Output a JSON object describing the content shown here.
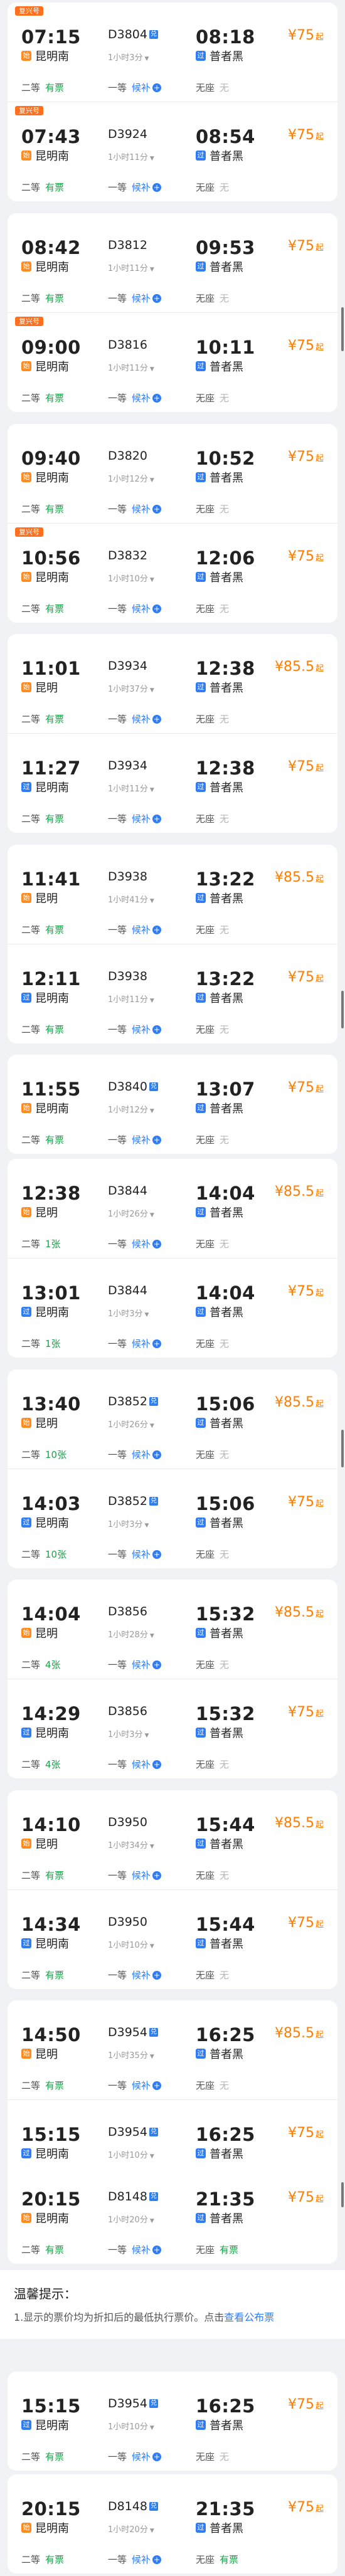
{
  "labels": {
    "second_class": "二等",
    "first_class": "一等",
    "no_seat": "无座",
    "from_suffix": "起",
    "revision_tag": "复兴号",
    "revision_badge": "兑",
    "start_icon": "始",
    "pass_icon": "过"
  },
  "groups": [
    {
      "trains": [
        {
          "tag": "复兴号",
          "dep_time": "07:15",
          "train_no": "D3804",
          "badge": true,
          "arr_time": "08:18",
          "dep_station": "昆明南",
          "dep_type": "start",
          "arr_station": "普者黑",
          "duration": "1小时3分",
          "price": "¥75",
          "second": "有票",
          "first": "候补",
          "none": "无"
        },
        {
          "tag": "复兴号",
          "dep_time": "07:43",
          "train_no": "D3924",
          "badge": false,
          "arr_time": "08:54",
          "dep_station": "昆明南",
          "dep_type": "start",
          "arr_station": "普者黑",
          "duration": "1小时11分",
          "price": "¥75",
          "second": "有票",
          "first": "候补",
          "none": "无"
        }
      ]
    },
    {
      "trains": [
        {
          "tag": "",
          "dep_time": "08:42",
          "train_no": "D3812",
          "badge": false,
          "arr_time": "09:53",
          "dep_station": "昆明南",
          "dep_type": "start",
          "arr_station": "普者黑",
          "duration": "1小时11分",
          "price": "¥75",
          "second": "有票",
          "first": "候补",
          "none": "无"
        },
        {
          "tag": "复兴号",
          "dep_time": "09:00",
          "train_no": "D3816",
          "badge": false,
          "arr_time": "10:11",
          "dep_station": "昆明南",
          "dep_type": "start",
          "arr_station": "普者黑",
          "duration": "1小时11分",
          "price": "¥75",
          "second": "有票",
          "first": "候补",
          "none": "无"
        }
      ]
    },
    {
      "trains": [
        {
          "tag": "",
          "dep_time": "09:40",
          "train_no": "D3820",
          "badge": false,
          "arr_time": "10:52",
          "dep_station": "昆明南",
          "dep_type": "start",
          "arr_station": "普者黑",
          "duration": "1小时12分",
          "price": "¥75",
          "second": "有票",
          "first": "候补",
          "none": "无"
        },
        {
          "tag": "复兴号",
          "dep_time": "10:56",
          "train_no": "D3832",
          "badge": false,
          "arr_time": "12:06",
          "dep_station": "昆明南",
          "dep_type": "start",
          "arr_station": "普者黑",
          "duration": "1小时10分",
          "price": "¥75",
          "second": "有票",
          "first": "候补",
          "none": "无"
        }
      ]
    },
    {
      "trains": [
        {
          "tag": "",
          "dep_time": "11:01",
          "train_no": "D3934",
          "badge": false,
          "arr_time": "12:38",
          "dep_station": "昆明",
          "dep_type": "start",
          "arr_station": "普者黑",
          "duration": "1小时37分",
          "price": "¥85.5",
          "second": "有票",
          "first": "候补",
          "none": "无"
        },
        {
          "tag": "",
          "dep_time": "11:27",
          "train_no": "D3934",
          "badge": false,
          "arr_time": "12:38",
          "dep_station": "昆明南",
          "dep_type": "pass",
          "arr_station": "普者黑",
          "duration": "1小时11分",
          "price": "¥75",
          "second": "有票",
          "first": "候补",
          "none": "无"
        }
      ]
    },
    {
      "trains": [
        {
          "tag": "",
          "dep_time": "11:41",
          "train_no": "D3938",
          "badge": false,
          "arr_time": "13:22",
          "dep_station": "昆明",
          "dep_type": "start",
          "arr_station": "普者黑",
          "duration": "1小时41分",
          "price": "¥85.5",
          "second": "有票",
          "first": "候补",
          "none": "无"
        },
        {
          "tag": "",
          "dep_time": "12:11",
          "train_no": "D3938",
          "badge": false,
          "arr_time": "13:22",
          "dep_station": "昆明南",
          "dep_type": "pass",
          "arr_station": "普者黑",
          "duration": "1小时11分",
          "price": "¥75",
          "second": "有票",
          "first": "候补",
          "none": "无"
        }
      ]
    },
    {
      "trains": [
        {
          "tag": "",
          "dep_time": "11:55",
          "train_no": "D3840",
          "badge": true,
          "arr_time": "13:07",
          "dep_station": "昆明南",
          "dep_type": "start",
          "arr_station": "普者黑",
          "duration": "1小时12分",
          "price": "¥75",
          "second": "有票",
          "first": "候补",
          "none": "无"
        }
      ]
    },
    {
      "trains": [
        {
          "tag": "",
          "dep_time": "12:38",
          "train_no": "D3844",
          "badge": false,
          "arr_time": "14:04",
          "dep_station": "昆明",
          "dep_type": "start",
          "arr_station": "普者黑",
          "duration": "1小时26分",
          "price": "¥85.5",
          "second": "1张",
          "first": "候补",
          "none": "无"
        },
        {
          "tag": "",
          "dep_time": "13:01",
          "train_no": "D3844",
          "badge": false,
          "arr_time": "14:04",
          "dep_station": "昆明南",
          "dep_type": "pass",
          "arr_station": "普者黑",
          "duration": "1小时3分",
          "price": "¥75",
          "second": "1张",
          "first": "候补",
          "none": "无"
        }
      ]
    },
    {
      "trains": [
        {
          "tag": "",
          "dep_time": "13:40",
          "train_no": "D3852",
          "badge": true,
          "arr_time": "15:06",
          "dep_station": "昆明",
          "dep_type": "start",
          "arr_station": "普者黑",
          "duration": "1小时26分",
          "price": "¥85.5",
          "second": "10张",
          "first": "候补",
          "none": "无"
        },
        {
          "tag": "",
          "dep_time": "14:03",
          "train_no": "D3852",
          "badge": true,
          "arr_time": "15:06",
          "dep_station": "昆明南",
          "dep_type": "pass",
          "arr_station": "普者黑",
          "duration": "1小时3分",
          "price": "¥75",
          "second": "10张",
          "first": "候补",
          "none": "无"
        }
      ]
    },
    {
      "trains": [
        {
          "tag": "",
          "dep_time": "14:04",
          "train_no": "D3856",
          "badge": false,
          "arr_time": "15:32",
          "dep_station": "昆明",
          "dep_type": "start",
          "arr_station": "普者黑",
          "duration": "1小时28分",
          "price": "¥85.5",
          "second": "4张",
          "first": "候补",
          "none": "无"
        },
        {
          "tag": "",
          "dep_time": "14:29",
          "train_no": "D3856",
          "badge": false,
          "arr_time": "15:32",
          "dep_station": "昆明南",
          "dep_type": "pass",
          "arr_station": "普者黑",
          "duration": "1小时3分",
          "price": "¥75",
          "second": "4张",
          "first": "候补",
          "none": "无"
        }
      ]
    },
    {
      "trains": [
        {
          "tag": "",
          "dep_time": "14:10",
          "train_no": "D3950",
          "badge": false,
          "arr_time": "15:44",
          "dep_station": "昆明",
          "dep_type": "start",
          "arr_station": "普者黑",
          "duration": "1小时34分",
          "price": "¥85.5",
          "second": "有票",
          "first": "候补",
          "none": "无"
        },
        {
          "tag": "",
          "dep_time": "14:34",
          "train_no": "D3950",
          "badge": false,
          "arr_time": "15:44",
          "dep_station": "昆明南",
          "dep_type": "pass",
          "arr_station": "普者黑",
          "duration": "1小时10分",
          "price": "¥75",
          "second": "有票",
          "first": "候补",
          "none": "无"
        }
      ]
    },
    {
      "trains": [
        {
          "tag": "",
          "dep_time": "14:50",
          "train_no": "D3954",
          "badge": true,
          "arr_time": "16:25",
          "dep_station": "昆明",
          "dep_type": "start",
          "arr_station": "普者黑",
          "duration": "1小时35分",
          "price": "¥85.5",
          "second": "有票",
          "first": "候补",
          "none": "无"
        },
        {
          "tag": "",
          "dep_time": "15:15",
          "train_no": "D3954",
          "badge": true,
          "arr_time": "16:25",
          "dep_station": "昆明南",
          "dep_type": "pass",
          "arr_station": "普者黑",
          "duration": "1小时10分",
          "price": "¥75",
          "second": "有票",
          "first": "候补",
          "none": "无"
        }
      ]
    },
    {
      "trains": [
        {
          "tag": "",
          "dep_time": "20:15",
          "train_no": "D8148",
          "badge": true,
          "arr_time": "21:35",
          "dep_station": "昆明南",
          "dep_type": "start",
          "arr_station": "普者黑",
          "duration": "1小时20分",
          "price": "¥75",
          "second": "有票",
          "first": "候补",
          "none": "有票"
        }
      ]
    },
    {
      "trains": [
        {
          "tag": "",
          "dep_time": "15:15",
          "train_no": "D3954",
          "badge": true,
          "arr_time": "16:25",
          "dep_station": "昆明南",
          "dep_type": "pass",
          "arr_station": "普者黑",
          "duration": "1小时10分",
          "price": "¥75",
          "second": "有票",
          "first": "候补",
          "none": "无"
        }
      ]
    },
    {
      "trains": [
        {
          "tag": "",
          "dep_time": "20:15",
          "train_no": "D8148",
          "badge": true,
          "arr_time": "21:35",
          "dep_station": "昆明南",
          "dep_type": "start",
          "arr_station": "普者黑",
          "duration": "1小时20分",
          "price": "¥75",
          "second": "有票",
          "first": "候补",
          "none": "有票"
        }
      ]
    }
  ],
  "notice": {
    "title": "温馨提示：",
    "text": "1.显示的票价均为折扣后的最低执行票价。点击",
    "link": "查看公布票"
  }
}
